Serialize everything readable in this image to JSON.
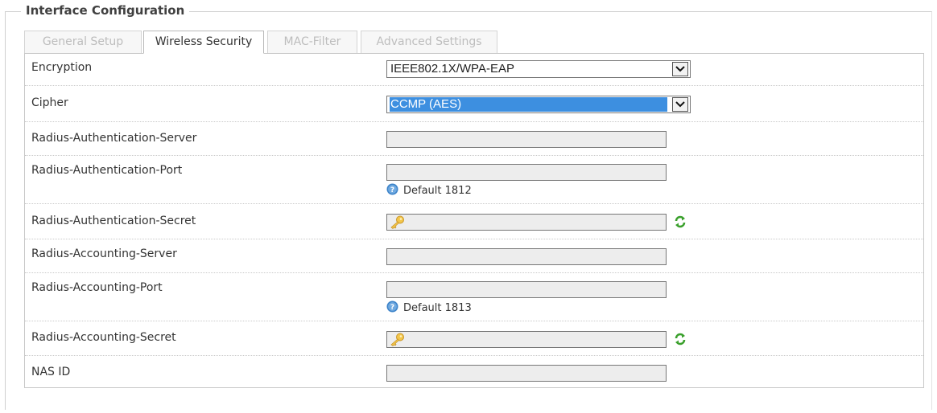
{
  "legend": "Interface Configuration",
  "tabs": [
    {
      "label": "General Setup",
      "active": false
    },
    {
      "label": "Wireless Security",
      "active": true
    },
    {
      "label": "MAC-Filter",
      "active": false
    },
    {
      "label": "Advanced Settings",
      "active": false
    }
  ],
  "fields": {
    "encryption": {
      "label": "Encryption",
      "value": "IEEE802.1X/WPA-EAP"
    },
    "cipher": {
      "label": "Cipher",
      "value": "CCMP (AES)"
    },
    "auth_server": {
      "label": "Radius-Authentication-Server",
      "value": ""
    },
    "auth_port": {
      "label": "Radius-Authentication-Port",
      "value": "",
      "hint": "Default 1812"
    },
    "auth_secret": {
      "label": "Radius-Authentication-Secret",
      "value": ""
    },
    "acct_server": {
      "label": "Radius-Accounting-Server",
      "value": ""
    },
    "acct_port": {
      "label": "Radius-Accounting-Port",
      "value": "",
      "hint": "Default 1813"
    },
    "acct_secret": {
      "label": "Radius-Accounting-Secret",
      "value": ""
    },
    "nas_id": {
      "label": "NAS ID",
      "value": ""
    }
  },
  "colors": {
    "highlight": "#3d8fe0",
    "input_bg": "#ededed"
  },
  "icons": {
    "dropdown": "chevron-down-icon",
    "secret": "key-icon",
    "reveal": "refresh-icon",
    "help": "help-icon"
  }
}
